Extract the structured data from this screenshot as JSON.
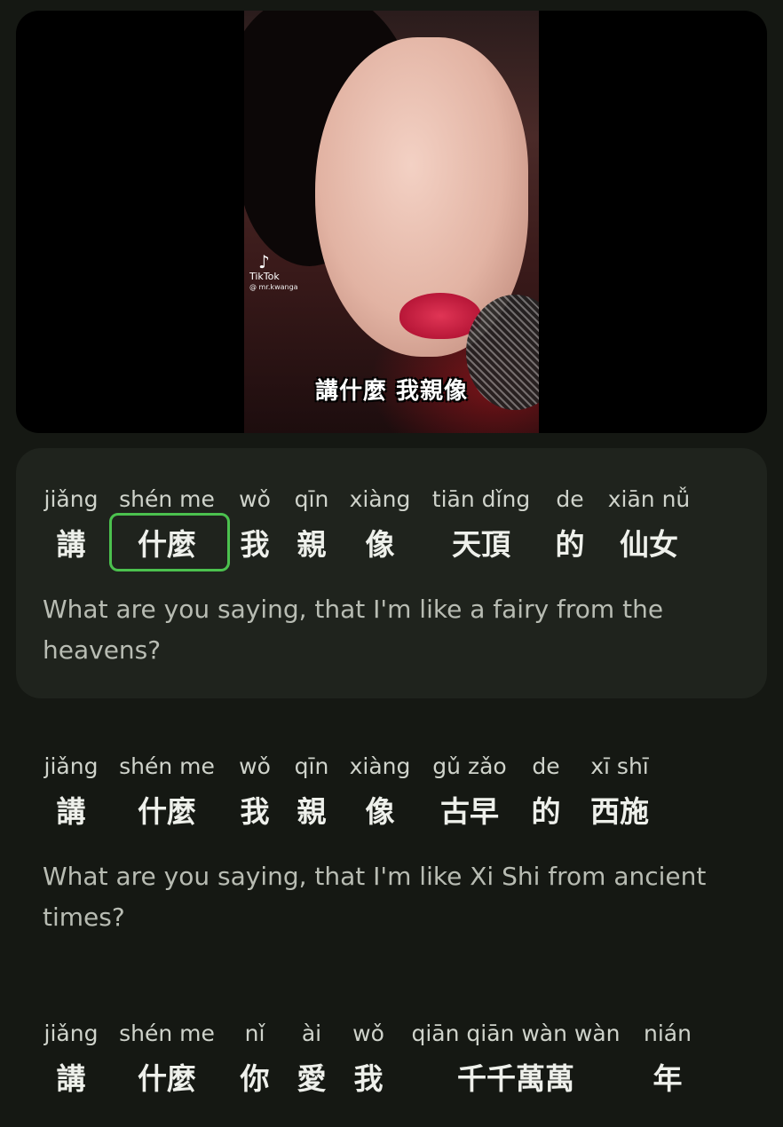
{
  "video": {
    "platform_label": "TikTok",
    "handle": "@ mr.kwanga",
    "subtitle": "講什麼 我親像"
  },
  "lyrics": [
    {
      "words": [
        {
          "pinyin": "jiǎng",
          "hanzi": "講"
        },
        {
          "pinyin": "shén me",
          "hanzi": "什麼",
          "active": true
        },
        {
          "pinyin": "wǒ",
          "hanzi": "我"
        },
        {
          "pinyin": "qīn",
          "hanzi": "親"
        },
        {
          "pinyin": "xiàng",
          "hanzi": "像"
        },
        {
          "pinyin": "tiān dǐng",
          "hanzi": "天頂"
        },
        {
          "pinyin": "de",
          "hanzi": "的"
        },
        {
          "pinyin": "xiān nǚ",
          "hanzi": "仙女"
        }
      ],
      "translation": "What are you saying, that I'm like a fairy from the heavens?"
    },
    {
      "words": [
        {
          "pinyin": "jiǎng",
          "hanzi": "講"
        },
        {
          "pinyin": "shén me",
          "hanzi": "什麼"
        },
        {
          "pinyin": "wǒ",
          "hanzi": "我"
        },
        {
          "pinyin": "qīn",
          "hanzi": "親"
        },
        {
          "pinyin": "xiàng",
          "hanzi": "像"
        },
        {
          "pinyin": "gǔ zǎo",
          "hanzi": "古早"
        },
        {
          "pinyin": "de",
          "hanzi": "的"
        },
        {
          "pinyin": "xī shī",
          "hanzi": "西施"
        }
      ],
      "translation": "What are you saying, that I'm like Xi Shi from ancient times?"
    },
    {
      "words": [
        {
          "pinyin": "jiǎng",
          "hanzi": "講"
        },
        {
          "pinyin": "shén me",
          "hanzi": "什麼"
        },
        {
          "pinyin": "nǐ",
          "hanzi": "你"
        },
        {
          "pinyin": "ài",
          "hanzi": "愛"
        },
        {
          "pinyin": "wǒ",
          "hanzi": "我"
        },
        {
          "pinyin": "qiān qiān wàn wàn",
          "hanzi": "千千萬萬"
        },
        {
          "pinyin": "nián",
          "hanzi": "年"
        }
      ],
      "translation": ""
    }
  ]
}
